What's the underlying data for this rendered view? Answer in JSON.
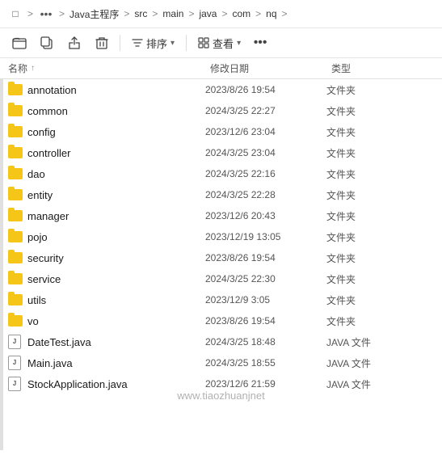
{
  "titlebar": {
    "window_icon": "□",
    "more_label": "•••",
    "path": [
      {
        "label": "Java主程序"
      },
      {
        "label": "src"
      },
      {
        "label": "main"
      },
      {
        "label": "java"
      },
      {
        "label": "com"
      },
      {
        "label": "nq"
      }
    ]
  },
  "toolbar": {
    "copy_icon": "⬡",
    "paste_icon": "⬡",
    "share_icon": "⬡",
    "delete_icon": "🗑",
    "sort_label": "排序",
    "view_label": "查看",
    "more_label": "•••"
  },
  "header": {
    "col_name": "名称",
    "col_date": "修改日期",
    "col_type": "类型"
  },
  "files": [
    {
      "name": "annotation",
      "date": "2023/8/26 19:54",
      "type": "文件夹",
      "kind": "folder"
    },
    {
      "name": "common",
      "date": "2024/3/25 22:27",
      "type": "文件夹",
      "kind": "folder"
    },
    {
      "name": "config",
      "date": "2023/12/6 23:04",
      "type": "文件夹",
      "kind": "folder"
    },
    {
      "name": "controller",
      "date": "2024/3/25 23:04",
      "type": "文件夹",
      "kind": "folder"
    },
    {
      "name": "dao",
      "date": "2024/3/25 22:16",
      "type": "文件夹",
      "kind": "folder"
    },
    {
      "name": "entity",
      "date": "2024/3/25 22:28",
      "type": "文件夹",
      "kind": "folder"
    },
    {
      "name": "manager",
      "date": "2023/12/6 20:43",
      "type": "文件夹",
      "kind": "folder"
    },
    {
      "name": "pojo",
      "date": "2023/12/19 13:05",
      "type": "文件夹",
      "kind": "folder"
    },
    {
      "name": "security",
      "date": "2023/8/26 19:54",
      "type": "文件夹",
      "kind": "folder"
    },
    {
      "name": "service",
      "date": "2024/3/25 22:30",
      "type": "文件夹",
      "kind": "folder"
    },
    {
      "name": "utils",
      "date": "2023/12/9 3:05",
      "type": "文件夹",
      "kind": "folder"
    },
    {
      "name": "vo",
      "date": "2023/8/26 19:54",
      "type": "文件夹",
      "kind": "folder"
    },
    {
      "name": "DateTest.java",
      "date": "2024/3/25 18:48",
      "type": "JAVA 文件",
      "kind": "java"
    },
    {
      "name": "Main.java",
      "date": "2024/3/25 18:55",
      "type": "JAVA 文件",
      "kind": "java"
    },
    {
      "name": "StockApplication.java",
      "date": "2023/12/6 21:59",
      "type": "JAVA 文件",
      "kind": "java"
    }
  ],
  "watermark": "www.tiaozhuanjnet"
}
